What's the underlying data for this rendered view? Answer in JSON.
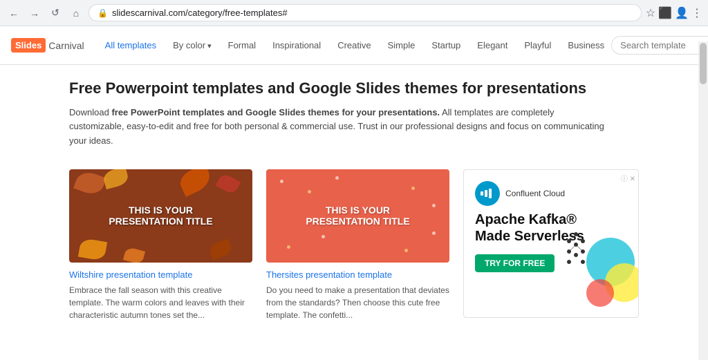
{
  "browser": {
    "url": "slidescarnival.com/category/free-templates#",
    "nav_back": "←",
    "nav_forward": "→",
    "nav_reload": "↺",
    "nav_home": "⌂"
  },
  "site": {
    "logo_slides": "Slides",
    "logo_carnival": "Carnival",
    "nav": {
      "all_templates": "All templates",
      "by_color": "By color",
      "formal": "Formal",
      "inspirational": "Inspirational",
      "creative": "Creative",
      "simple": "Simple",
      "startup": "Startup",
      "elegant": "Elegant",
      "playful": "Playful",
      "business": "Business"
    },
    "search_placeholder": "Search template"
  },
  "main": {
    "title": "Free Powerpoint templates and Google Slides themes for presentations",
    "desc_prefix": "Download ",
    "desc_bold": "free PowerPoint templates and Google Slides themes for your presentations.",
    "desc_suffix": " All templates are completely customizable, easy-to-edit and free for both personal & commercial use. Trust in our professional designs and focus on communicating your ideas."
  },
  "templates": [
    {
      "id": "wiltshire",
      "name": "Wiltshire presentation template",
      "desc": "Embrace the fall season with this creative template. The warm colors and leaves with their characteristic autumn tones set the...",
      "title_line1": "THIS IS YOUR",
      "title_line2": "PRESENTATION TITLE"
    },
    {
      "id": "thersites",
      "name": "Thersites presentation template",
      "desc": "Do you need to make a presentation that deviates from the standards? Then choose this cute free template. The confetti...",
      "title_line1": "THIS IS YOUR",
      "title_line2": "PRESENTATION TITLE"
    }
  ],
  "ad": {
    "badge": "ⓘ ✕",
    "logo_symbol": "≈",
    "brand": "Confluent Cloud",
    "headline": "Apache Kafka®\nMade Serverless",
    "cta": "TRY FOR FREE"
  },
  "colors": {
    "link_blue": "#1a73e8",
    "accent_orange": "#ff6b35",
    "wiltshire_bg": "#8b3a1a",
    "thersites_bg": "#e8614a",
    "ad_cta": "#00a86b"
  }
}
